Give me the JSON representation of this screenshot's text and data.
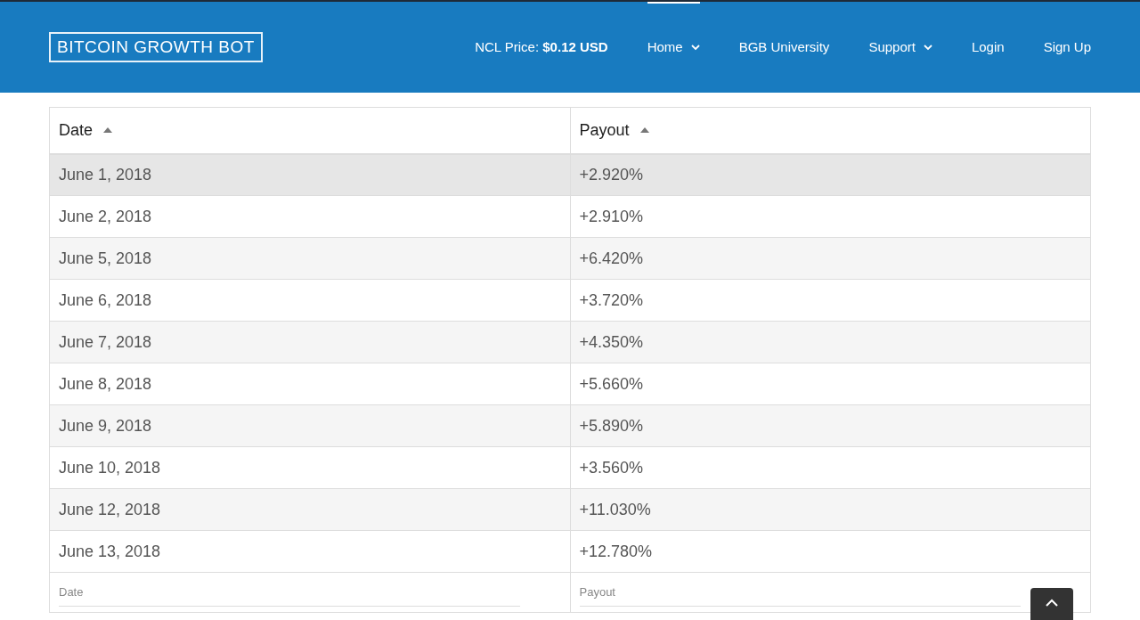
{
  "header": {
    "logo": "BITCOIN GROWTH BOT",
    "price_label": "NCL Price:",
    "price_value": "$0.12 USD",
    "nav": [
      {
        "label": "Home",
        "dropdown": true,
        "selected": true
      },
      {
        "label": "BGB University",
        "dropdown": false,
        "selected": false
      },
      {
        "label": "Support",
        "dropdown": true,
        "selected": false
      },
      {
        "label": "Login",
        "dropdown": false,
        "selected": false
      },
      {
        "label": "Sign Up",
        "dropdown": false,
        "selected": false
      }
    ]
  },
  "table": {
    "columns": [
      "Date",
      "Payout"
    ],
    "rows": [
      {
        "cells": [
          "June 1, 2018",
          "+2.920%"
        ],
        "selected": true
      },
      {
        "cells": [
          "June 2, 2018",
          "+2.910%"
        ],
        "selected": false
      },
      {
        "cells": [
          "June 5, 2018",
          "+6.420%"
        ],
        "selected": false
      },
      {
        "cells": [
          "June 6, 2018",
          "+3.720%"
        ],
        "selected": false
      },
      {
        "cells": [
          "June 7, 2018",
          "+4.350%"
        ],
        "selected": false
      },
      {
        "cells": [
          "June 8, 2018",
          "+5.660%"
        ],
        "selected": false
      },
      {
        "cells": [
          "June 9, 2018",
          "+5.890%"
        ],
        "selected": false
      },
      {
        "cells": [
          "June 10, 2018",
          "+3.560%"
        ],
        "selected": false
      },
      {
        "cells": [
          "June 12, 2018",
          "+11.030%"
        ],
        "selected": false
      },
      {
        "cells": [
          "June 13, 2018",
          "+12.780%"
        ],
        "selected": false
      }
    ],
    "filters": [
      {
        "placeholder": "Date"
      },
      {
        "placeholder": "Payout"
      }
    ]
  }
}
